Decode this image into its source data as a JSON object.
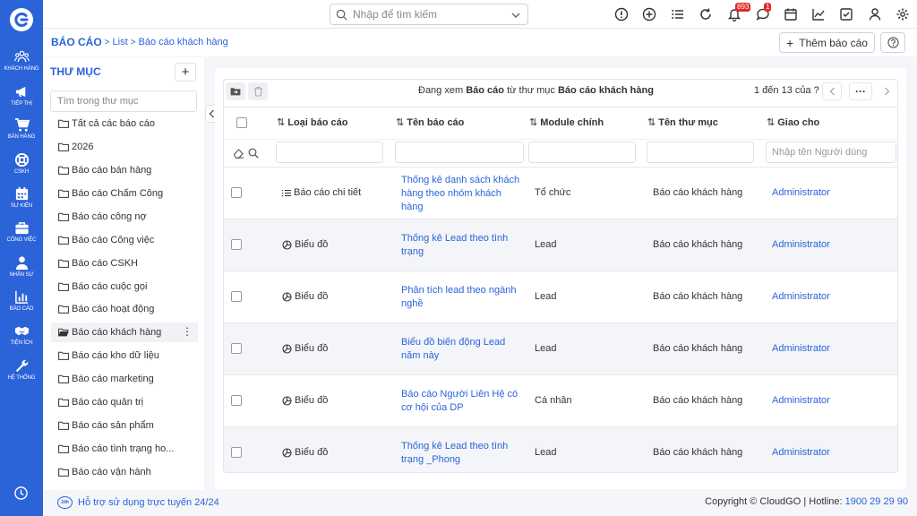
{
  "sidebar": {
    "items": [
      {
        "label": "KHÁCH HÀNG",
        "icon": "users-icon"
      },
      {
        "label": "TIẾP THỊ",
        "icon": "megaphone-icon"
      },
      {
        "label": "BÁN HÀNG",
        "icon": "cart-icon"
      },
      {
        "label": "CSKH",
        "icon": "support-icon"
      },
      {
        "label": "SỰ KIỆN",
        "icon": "calendar-icon"
      },
      {
        "label": "CÔNG VIỆC",
        "icon": "briefcase-icon"
      },
      {
        "label": "NHÂN SỰ",
        "icon": "person-icon"
      },
      {
        "label": "BÁO CÁO",
        "icon": "report-icon"
      },
      {
        "label": "TIỆN ÍCH",
        "icon": "handshake-icon"
      },
      {
        "label": "HỆ THỐNG",
        "icon": "wrench-icon"
      }
    ]
  },
  "topbar": {
    "search_placeholder": "Nhập để tìm kiếm",
    "notifications_count": "893",
    "messages_count": "1"
  },
  "breadcrumb": {
    "root": "BÁO CÁO",
    "level1": "List",
    "level2": "Báo cáo khách hàng"
  },
  "add_report_label": "Thêm báo cáo",
  "folders": {
    "title": "THƯ MỤC",
    "search_placeholder": "Tìm trong thư mục",
    "items": [
      "Tất cả các báo cáo",
      "2026",
      "Báo cáo bán hàng",
      "Báo cáo Chấm Công",
      "Báo cáo công nợ",
      "Báo cáo Công việc",
      "Báo cáo CSKH",
      "Báo cáo cuộc gọi",
      "Báo cáo hoạt động",
      "Báo cáo khách hàng",
      "Báo cáo kho dữ liệu",
      "Báo cáo marketing",
      "Báo cáo quản trị",
      "Báo cáo sản phẩm",
      "Báo cáo tình trạng ho...",
      "Báo cáo vận hành"
    ],
    "active": "Báo cáo khách hàng"
  },
  "viewing": {
    "prefix": "Đang xem",
    "module": "Báo cáo",
    "middle": "từ thư mục",
    "folder": "Báo cáo khách hàng"
  },
  "paging": "1 đến 13 của ?",
  "table": {
    "columns": [
      "Loại báo cáo",
      "Tên báo cáo",
      "Module chính",
      "Tên thư mục",
      "Giao cho"
    ],
    "assignee_filter_placeholder": "Nhập tên Người dùng",
    "rows": [
      {
        "type": "Báo cáo chi tiết",
        "type_icon": "list-icon",
        "name": "Thống kê danh sách khách hàng theo nhóm khách hàng",
        "module": "Tổ chức",
        "folder": "Báo cáo khách hàng",
        "assignee": "Administrator"
      },
      {
        "type": "Biểu đồ",
        "type_icon": "pie-chart-icon",
        "name": "Thống kê Lead theo tình trạng",
        "module": "Lead",
        "folder": "Báo cáo khách hàng",
        "assignee": "Administrator"
      },
      {
        "type": "Biểu đồ",
        "type_icon": "pie-chart-icon",
        "name": "Phân tích lead theo ngành nghề",
        "module": "Lead",
        "folder": "Báo cáo khách hàng",
        "assignee": "Administrator"
      },
      {
        "type": "Biểu đồ",
        "type_icon": "pie-chart-icon",
        "name": "Biểu đồ biến động Lead năm này",
        "module": "Lead",
        "folder": "Báo cáo khách hàng",
        "assignee": "Administrator"
      },
      {
        "type": "Biểu đồ",
        "type_icon": "pie-chart-icon",
        "name": "Báo cáo Người Liên Hệ có cơ hội của DP",
        "module": "Cá nhân",
        "folder": "Báo cáo khách hàng",
        "assignee": "Administrator"
      },
      {
        "type": "Biểu đồ",
        "type_icon": "pie-chart-icon",
        "name": "Thống kê Lead theo tình trạng _Phong",
        "module": "Lead",
        "folder": "Báo cáo khách hàng",
        "assignee": "Administrator"
      }
    ]
  },
  "footer": {
    "support_logo": "24h",
    "support": "Hỗ trợ sử dụng trực tuyến 24/24",
    "copyright": "Copyright © CloudGO",
    "hotline_label": "Hotline:",
    "hotline": "1900 29 29 90"
  },
  "colors": {
    "primary": "#2b63d9",
    "badge": "#e0292b"
  }
}
